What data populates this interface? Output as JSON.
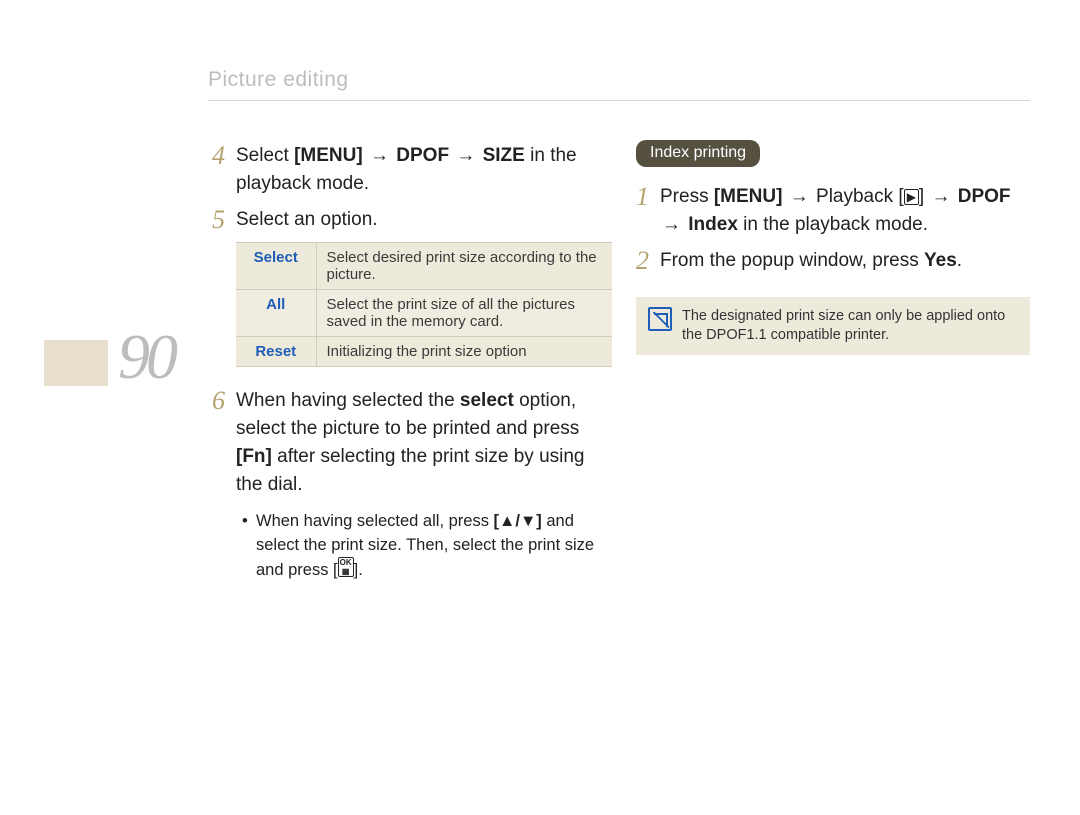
{
  "header": {
    "section_title": "Picture editing"
  },
  "page_number": "90",
  "left": {
    "step4": {
      "num": "4",
      "text_pre": "Select ",
      "menu": "[MENU]",
      "arrow1": "→",
      "dpof": "DPOF",
      "arrow2": "→",
      "size": "SIZE",
      "text_post": " in the playback mode."
    },
    "step5": {
      "num": "5",
      "text": "Select an option."
    },
    "options": [
      {
        "key": "Select",
        "desc": "Select desired print size according to the picture."
      },
      {
        "key": "All",
        "desc": "Select the print size of all the pictures saved in the memory card."
      },
      {
        "key": "Reset",
        "desc": "Initializing the print size option"
      }
    ],
    "step6": {
      "num": "6",
      "t1": "When having selected the ",
      "sel": "select",
      "t2": " option, select the picture to be printed and press ",
      "fn": "[Fn]",
      "t3": " after selecting the print size by using the dial."
    },
    "bullet": {
      "t1": "When having selected all, press ",
      "keys": "[▲/▼]",
      "t2": " and select the print size. Then, select the print size and press [",
      "ok_top": "OK",
      "ok_bot": "▦",
      "t3": "]."
    }
  },
  "right": {
    "pill": "Index printing",
    "step1": {
      "num": "1",
      "t1": "Press ",
      "menu": "[MENU]",
      "arrow1": "→",
      "playback": " Playback ",
      "pbkey": "▶",
      "arrow2": "→",
      "dpof": " DPOF ",
      "arrow3": "→",
      "index": " Index",
      "t2": " in the playback mode."
    },
    "step2": {
      "num": "2",
      "t1": "From the popup window, press ",
      "yes": "Yes",
      "t2": "."
    },
    "note": "The designated print size can only be applied onto the DPOF1.1 compatible printer."
  }
}
